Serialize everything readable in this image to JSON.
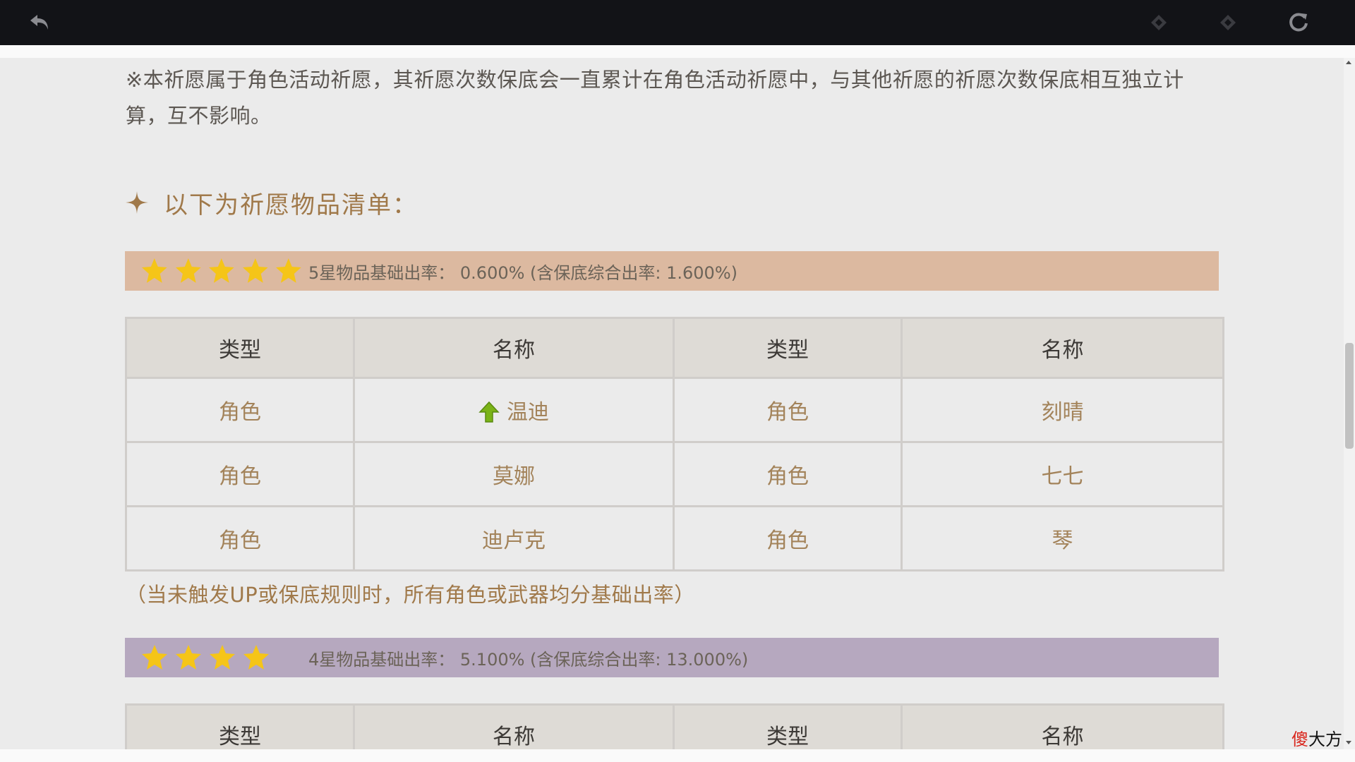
{
  "toolbar": {
    "back_icon": "back-arrow-icon",
    "prev_icon": "prev-diamond-icon",
    "next_icon": "next-diamond-icon",
    "refresh_icon": "refresh-icon"
  },
  "note": "※本祈愿属于角色活动祈愿，其祈愿次数保底会一直累计在角色活动祈愿中，与其他祈愿的祈愿次数保底相互独立计算，互不影响。",
  "section_title": "以下为祈愿物品清单：",
  "five_star": {
    "star_count": 5,
    "rate_text": "5星物品基础出率： 0.600% (含保底综合出率: 1.600%)",
    "bar_color": "#dcb9a0",
    "headers": [
      "类型",
      "名称",
      "类型",
      "名称"
    ],
    "rows": [
      {
        "type1": "角色",
        "name1": "温迪",
        "up1": true,
        "type2": "角色",
        "name2": "刻晴"
      },
      {
        "type1": "角色",
        "name1": "莫娜",
        "up1": false,
        "type2": "角色",
        "name2": "七七"
      },
      {
        "type1": "角色",
        "name1": "迪卢克",
        "up1": false,
        "type2": "角色",
        "name2": "琴"
      }
    ]
  },
  "footnote": "（当未触发UP或保底规则时，所有角色或武器均分基础出率）",
  "four_star": {
    "star_count": 4,
    "rate_text": "4星物品基础出率： 5.100% (含保底综合出率: 13.000%)",
    "bar_color": "#b6a8bf",
    "headers": [
      "类型",
      "名称",
      "类型",
      "名称"
    ]
  },
  "colors": {
    "accent_text": "#a0794a",
    "star": "#f5c518",
    "up_arrow": "#7ab317"
  },
  "watermark": {
    "red": "傻",
    "black": "大方"
  }
}
